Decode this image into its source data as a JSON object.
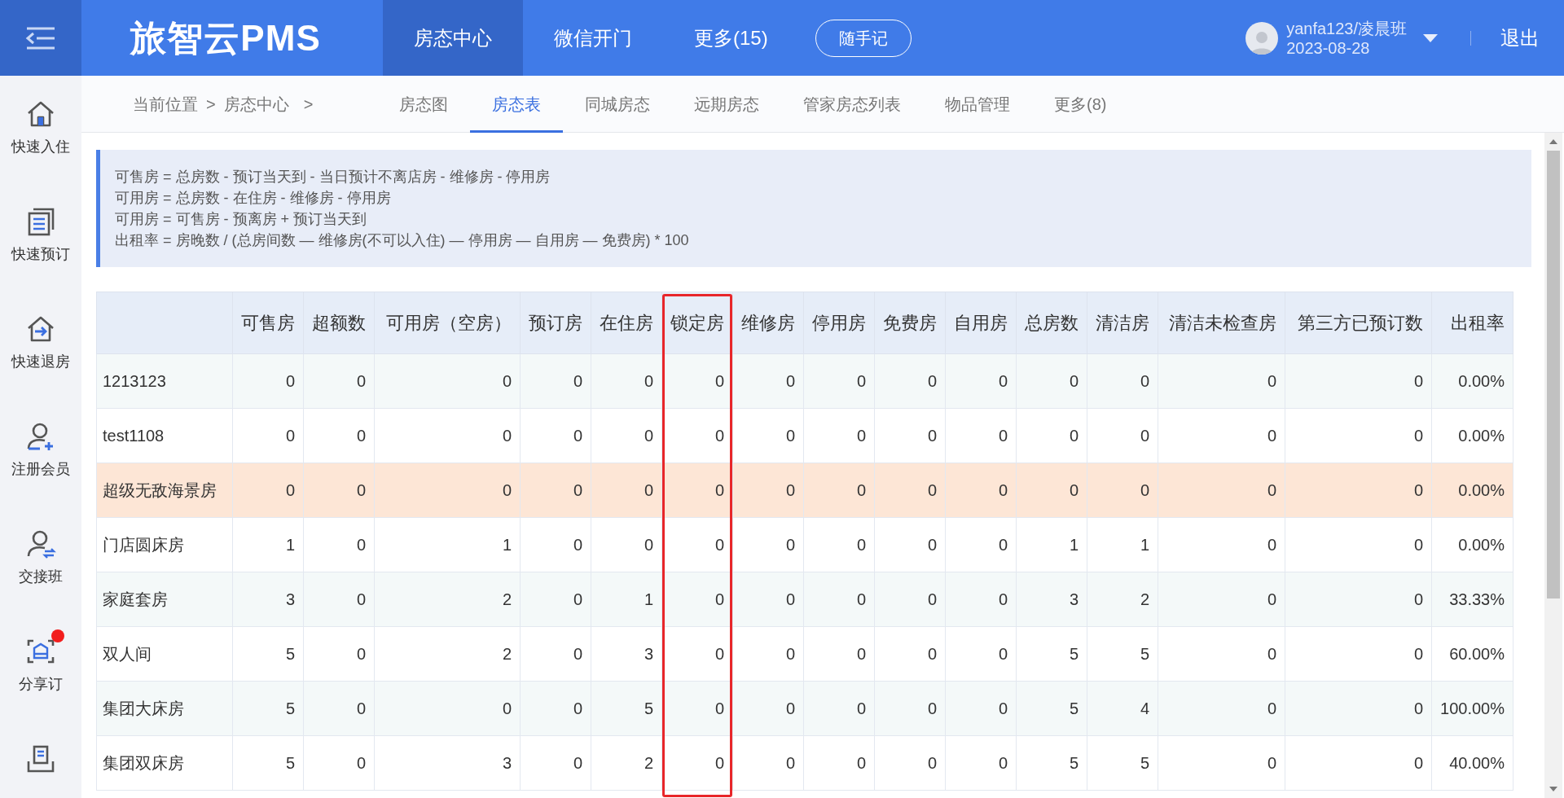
{
  "header": {
    "logo": "旅智云PMS",
    "nav": [
      {
        "label": "房态中心",
        "selected": true
      },
      {
        "label": "微信开门",
        "selected": false
      },
      {
        "label": "更多(15)",
        "selected": false
      }
    ],
    "note_button": "随手记",
    "user": {
      "name": "yanfa123/凌晨班",
      "date": "2023-08-28"
    },
    "logout": "退出"
  },
  "sidebar": {
    "items": [
      {
        "label": "快速入住",
        "badge": false
      },
      {
        "label": "快速预订",
        "badge": false
      },
      {
        "label": "快速退房",
        "badge": false
      },
      {
        "label": "注册会员",
        "badge": false
      },
      {
        "label": "交接班",
        "badge": false
      },
      {
        "label": "分享订",
        "badge": true
      }
    ]
  },
  "breadcrumb": {
    "prefix": "当前位置",
    "separator_1": ">",
    "current": "房态中心",
    "separator_2": ">"
  },
  "subnav": [
    {
      "label": "房态图",
      "selected": false
    },
    {
      "label": "房态表",
      "selected": true
    },
    {
      "label": "同城房态",
      "selected": false
    },
    {
      "label": "远期房态",
      "selected": false
    },
    {
      "label": "管家房态列表",
      "selected": false
    },
    {
      "label": "物品管理",
      "selected": false
    },
    {
      "label": "更多(8)",
      "selected": false
    }
  ],
  "formulas": [
    "可售房 = 总房数 - 预订当天到 - 当日预计不离店房 - 维修房 - 停用房",
    "可用房 = 总房数 - 在住房 - 维修房 - 停用房",
    "可用房 = 可售房 - 预离房 + 预订当天到",
    "出租率 = 房晚数 / (总房间数 — 维修房(不可以入住) — 停用房 — 自用房 — 免费房) * 100"
  ],
  "table": {
    "columns": [
      {
        "highlighted": false
      },
      {
        "label": "可售房",
        "highlighted": false
      },
      {
        "label": "超额数",
        "highlighted": false
      },
      {
        "label": "可用房（空房）",
        "highlighted": false
      },
      {
        "label": "预订房",
        "highlighted": false
      },
      {
        "label": "在住房",
        "highlighted": false
      },
      {
        "label": "锁定房",
        "highlighted": true
      },
      {
        "label": "维修房",
        "highlighted": false
      },
      {
        "label": "停用房",
        "highlighted": false
      },
      {
        "label": "免费房",
        "highlighted": false
      },
      {
        "label": "自用房",
        "highlighted": false
      },
      {
        "label": "总房数",
        "highlighted": false
      },
      {
        "label": "清洁房",
        "highlighted": false
      },
      {
        "label": "清洁未检查房",
        "highlighted": false
      },
      {
        "label": "第三方已预订数",
        "highlighted": false
      },
      {
        "label": "出租率",
        "highlighted": false
      }
    ],
    "rows": [
      {
        "selected": false,
        "cells": [
          "1213123",
          "0",
          "0",
          "0",
          "0",
          "0",
          "0",
          "0",
          "0",
          "0",
          "0",
          "0",
          "0",
          "0",
          "0",
          "0.00%"
        ]
      },
      {
        "selected": false,
        "cells": [
          "test1108",
          "0",
          "0",
          "0",
          "0",
          "0",
          "0",
          "0",
          "0",
          "0",
          "0",
          "0",
          "0",
          "0",
          "0",
          "0.00%"
        ]
      },
      {
        "selected": true,
        "cells": [
          "超级无敌海景房",
          "0",
          "0",
          "0",
          "0",
          "0",
          "0",
          "0",
          "0",
          "0",
          "0",
          "0",
          "0",
          "0",
          "0",
          "0.00%"
        ]
      },
      {
        "selected": false,
        "cells": [
          "门店圆床房",
          "1",
          "0",
          "1",
          "0",
          "0",
          "0",
          "0",
          "0",
          "0",
          "0",
          "1",
          "1",
          "0",
          "0",
          "0.00%"
        ]
      },
      {
        "selected": false,
        "cells": [
          "家庭套房",
          "3",
          "0",
          "2",
          "0",
          "1",
          "0",
          "0",
          "0",
          "0",
          "0",
          "3",
          "2",
          "0",
          "0",
          "33.33%"
        ]
      },
      {
        "selected": false,
        "cells": [
          "双人间",
          "5",
          "0",
          "2",
          "0",
          "3",
          "0",
          "0",
          "0",
          "0",
          "0",
          "5",
          "5",
          "0",
          "0",
          "60.00%"
        ]
      },
      {
        "selected": false,
        "cells": [
          "集团大床房",
          "5",
          "0",
          "0",
          "0",
          "5",
          "0",
          "0",
          "0",
          "0",
          "0",
          "5",
          "4",
          "0",
          "0",
          "100.00%"
        ]
      },
      {
        "selected": false,
        "cells": [
          "集团双床房",
          "5",
          "0",
          "3",
          "0",
          "2",
          "0",
          "0",
          "0",
          "0",
          "0",
          "5",
          "5",
          "0",
          "0",
          "40.00%"
        ]
      }
    ]
  }
}
